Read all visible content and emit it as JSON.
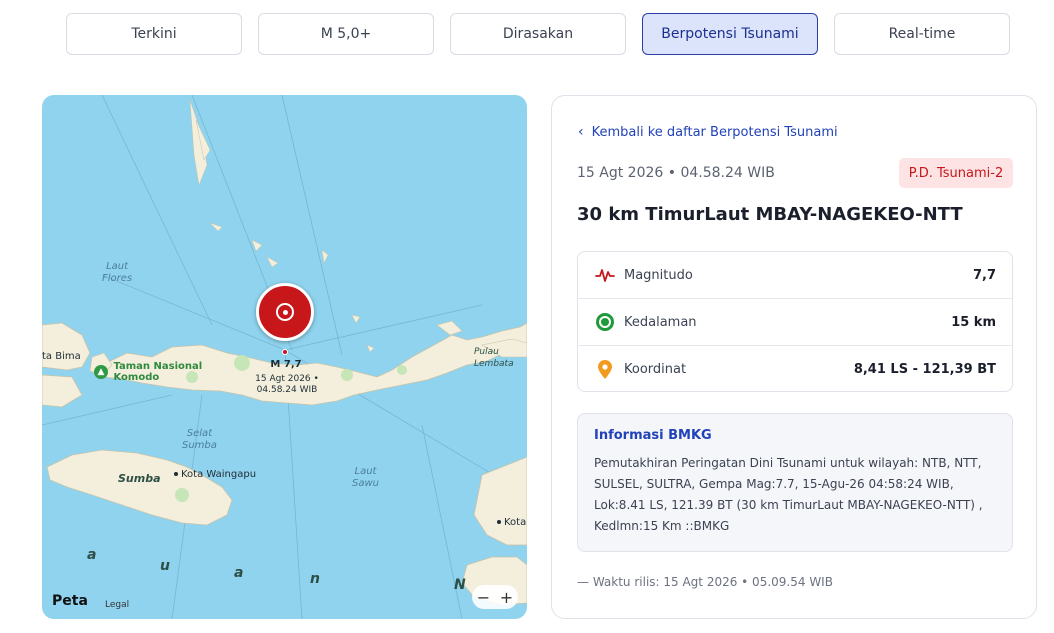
{
  "tabs": [
    {
      "label": "Terkini"
    },
    {
      "label": "M 5,0+"
    },
    {
      "label": "Dirasakan"
    },
    {
      "label": "Berpotensi Tsunami"
    },
    {
      "label": "Real-time"
    }
  ],
  "map": {
    "sea_labels": [
      "Laut\nFlores",
      "Selat\nSumba",
      "Laut\nSawu"
    ],
    "places": {
      "bima": "ta Bima",
      "komodo": "Taman Nasional\nKomodo",
      "waingapu": "Kota Waingapu",
      "sumba": "Sumba",
      "lembata": "Pulau\nLembata",
      "kota_right": "Kota"
    },
    "sea_letters": [
      "a",
      "u",
      "a",
      "n",
      "N"
    ],
    "quake_magnitude": "M 7,7",
    "quake_time": "15 Agt 2026 •\n04.58.24 WIB",
    "attribution_logo": "Peta",
    "attribution_legal": "Legal",
    "zoom_out": "−",
    "zoom_in": "+"
  },
  "detail": {
    "back_link": "Kembali ke daftar Berpotensi Tsunami",
    "datetime": "15 Agt 2026 • 04.58.24 WIB",
    "badge": "P.D. Tsunami-2",
    "title": "30 km TimurLaut MBAY-NAGEKEO-NTT",
    "stats": [
      {
        "label": "Magnitudo",
        "value": "7,7"
      },
      {
        "label": "Kedalaman",
        "value": "15 km"
      },
      {
        "label": "Koordinat",
        "value": "8,41 LS - 121,39 BT"
      }
    ],
    "info_title": "Informasi BMKG",
    "info_text": "Pemutakhiran Peringatan Dini Tsunami untuk wilayah: NTB, NTT, SULSEL, SULTRA, Gempa Mag:7.7, 15-Agu-26 04:58:24 WIB, Lok:8.41 LS, 121.39 BT (30 km TimurLaut MBAY-NAGEKEO-NTT) , Kedlmn:15 Km ::BMKG",
    "release": "— Waktu rilis: 15 Agt 2026 • 05.09.54 WIB"
  },
  "colors": {
    "accent": "#2142b8",
    "danger": "#c8171a",
    "sea": "#8fd3ee",
    "land": "#f3efdc"
  }
}
